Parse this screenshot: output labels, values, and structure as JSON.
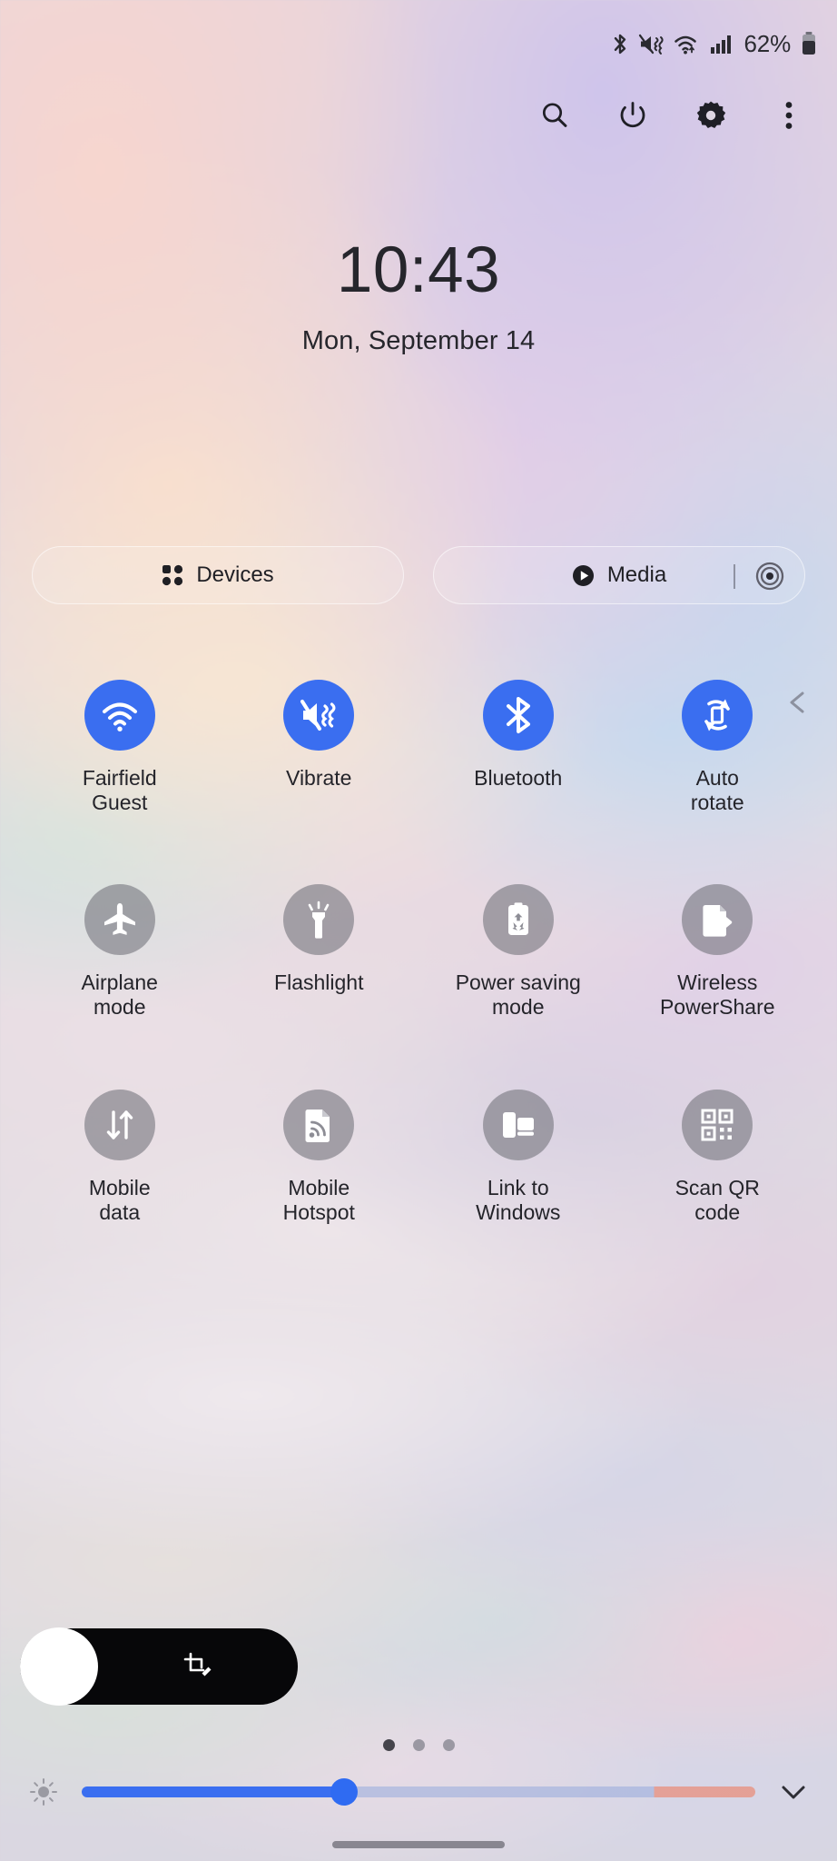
{
  "status_bar": {
    "icons": [
      "bluetooth-icon",
      "vibrate-icon",
      "wifi-icon",
      "signal-icon"
    ],
    "battery_percent": "62%",
    "battery_icon": "battery-icon"
  },
  "toolbar": {
    "buttons": [
      {
        "name": "search-button",
        "icon": "search-icon"
      },
      {
        "name": "power-button",
        "icon": "power-icon"
      },
      {
        "name": "settings-button",
        "icon": "gear-icon"
      },
      {
        "name": "more-options-button",
        "icon": "kebab-menu-icon"
      }
    ]
  },
  "clock": {
    "time": "10:43",
    "date": "Mon, September 14"
  },
  "tiles": {
    "devices": {
      "label": "Devices",
      "icon": "grid-dots-icon"
    },
    "media": {
      "label": "Media",
      "icon": "play-circle-icon",
      "output_icon": "media-output-icon"
    }
  },
  "quick_settings": {
    "rows": [
      [
        {
          "label": "Fairfield\nGuest",
          "label_line1": "Fairfield",
          "label_line2": "Guest",
          "icon": "wifi-icon",
          "state": "on"
        },
        {
          "label": "Vibrate",
          "label_line1": "Vibrate",
          "label_line2": "",
          "icon": "vibrate-icon",
          "state": "on"
        },
        {
          "label": "Bluetooth",
          "label_line1": "Bluetooth",
          "label_line2": "",
          "icon": "bluetooth-icon",
          "state": "on"
        },
        {
          "label": "Auto rotate",
          "label_line1": "Auto",
          "label_line2": "rotate",
          "icon": "auto-rotate-icon",
          "state": "on"
        }
      ],
      [
        {
          "label": "Airplane mode",
          "label_line1": "Airplane",
          "label_line2": "mode",
          "icon": "airplane-icon",
          "state": "off"
        },
        {
          "label": "Flashlight",
          "label_line1": "Flashlight",
          "label_line2": "",
          "icon": "flashlight-icon",
          "state": "off"
        },
        {
          "label": "Power saving mode",
          "label_line1": "Power saving",
          "label_line2": "mode",
          "icon": "power-saving-icon",
          "state": "off"
        },
        {
          "label": "Wireless PowerShare",
          "label_line1": "Wireless",
          "label_line2": "PowerShare",
          "icon": "wireless-powershare-icon",
          "state": "off"
        }
      ],
      [
        {
          "label": "Mobile data",
          "label_line1": "Mobile",
          "label_line2": "data",
          "icon": "mobile-data-icon",
          "state": "off"
        },
        {
          "label": "Mobile Hotspot",
          "label_line1": "Mobile",
          "label_line2": "Hotspot",
          "icon": "hotspot-icon",
          "state": "off"
        },
        {
          "label": "Link to Windows",
          "label_line1": "Link to",
          "label_line2": "Windows",
          "icon": "link-to-windows-icon",
          "state": "off"
        },
        {
          "label": "Scan QR code",
          "label_line1": "Scan QR",
          "label_line2": "code",
          "icon": "qr-code-icon",
          "state": "off"
        }
      ]
    ],
    "expand_chevron": "chevron-left-icon"
  },
  "media_pill": {
    "icon": "screenshot-edit-icon"
  },
  "page_indicator": {
    "total": 3,
    "active": 1
  },
  "brightness": {
    "low_icon": "brightness-low-icon",
    "value_percent": 39,
    "expand_icon": "chevron-down-icon"
  },
  "nav": {
    "handle": "nav-handle"
  },
  "colors": {
    "accent_blue": "#3a6ef0",
    "toggle_off_gray": "#787880",
    "text_dark": "#24242a"
  }
}
